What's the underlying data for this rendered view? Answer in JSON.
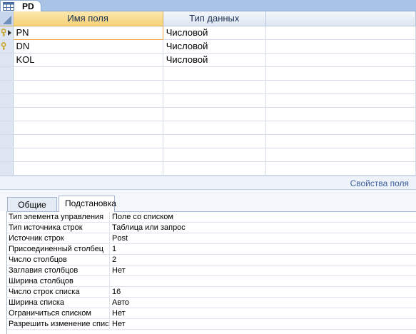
{
  "document": {
    "tab_label": "PD",
    "tab_icon": "table-icon"
  },
  "grid": {
    "columns": [
      "Имя поля",
      "Тип данных"
    ],
    "rows": [
      {
        "name": "PN",
        "type": "Числовой",
        "key": true,
        "current": true
      },
      {
        "name": "DN",
        "type": "Числовой",
        "key": true,
        "current": false
      },
      {
        "name": "KOL",
        "type": "Числовой",
        "key": false,
        "current": false
      }
    ]
  },
  "property_sheet": {
    "label": "Свойства поля",
    "tabs": [
      "Общие",
      "Подстановка"
    ],
    "active_tab": "Подстановка",
    "properties": [
      {
        "name": "Тип элемента управления",
        "value": "Поле со списком"
      },
      {
        "name": "Тип источника строк",
        "value": "Таблица или запрос"
      },
      {
        "name": "Источник строк",
        "value": "Post"
      },
      {
        "name": "Присоединенный столбец",
        "value": "1"
      },
      {
        "name": "Число столбцов",
        "value": "2"
      },
      {
        "name": "Заглавия столбцов",
        "value": "Нет"
      },
      {
        "name": "Ширина столбцов",
        "value": ""
      },
      {
        "name": "Число строк списка",
        "value": "16"
      },
      {
        "name": "Ширина списка",
        "value": "Авто"
      },
      {
        "name": "Ограничиться списком",
        "value": "Нет"
      },
      {
        "name": "Разрешить изменение списка",
        "value": "Нет"
      }
    ]
  },
  "colors": {
    "header_gold": "#f7d274",
    "accent_blue": "#3b5c9c",
    "key_icon": "#c9a227"
  }
}
